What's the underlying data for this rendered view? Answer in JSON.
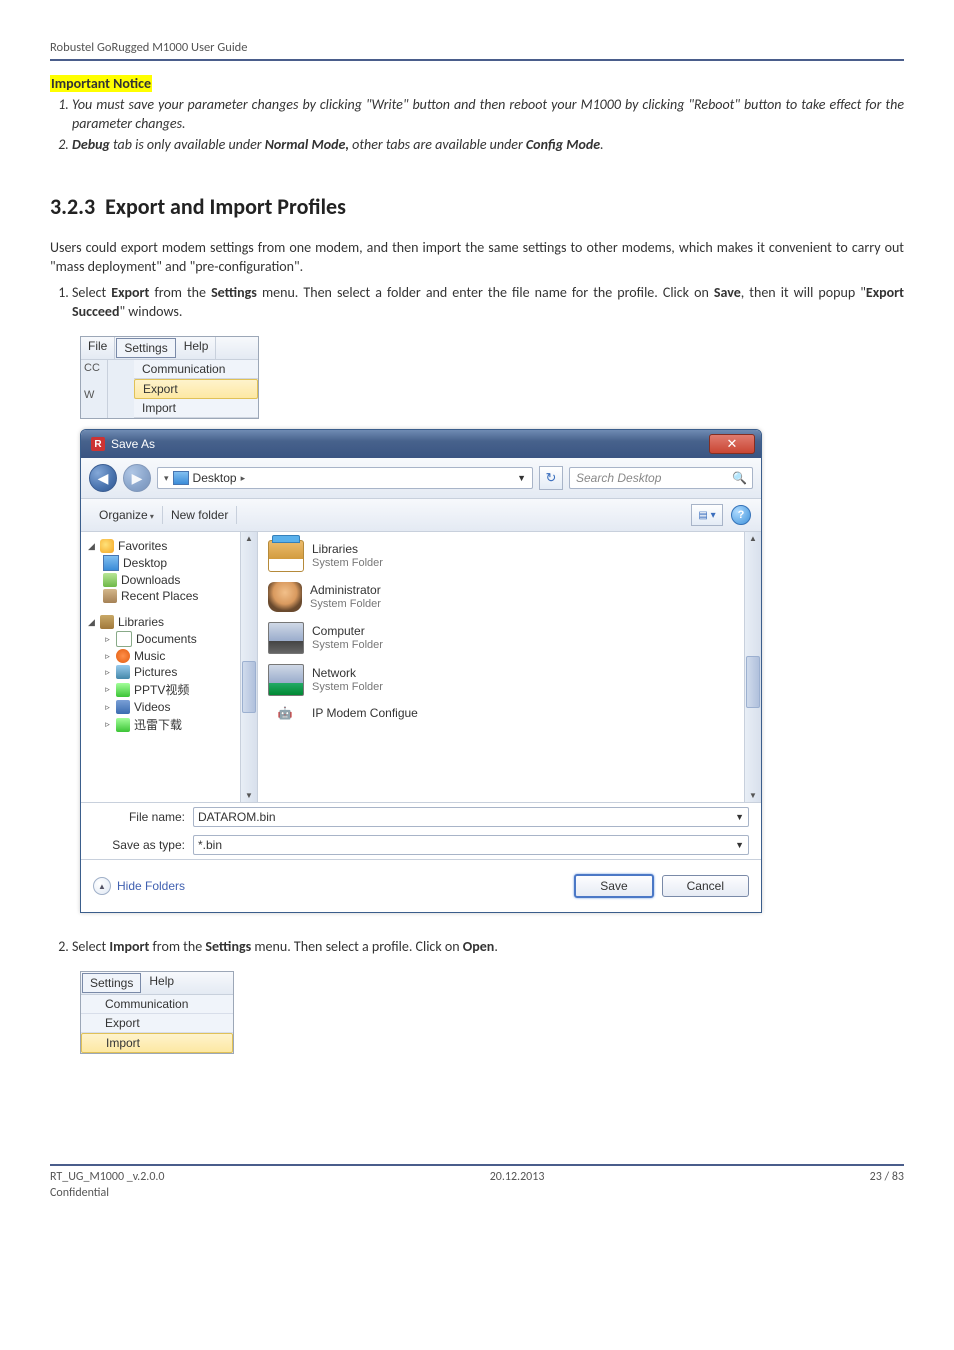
{
  "header": {
    "title": "Robustel GoRugged M1000 User Guide"
  },
  "notice_heading": "Important Notice",
  "notices": [
    "You must save your parameter changes by clicking \"Write\" button and then reboot your M1000 by clicking \"Reboot\" button to take effect for the parameter changes.",
    "Debug tab is only available under Normal Mode, other tabs are available under Config Mode."
  ],
  "notice_bold": {
    "debug": "Debug",
    "normal": "Normal Mode,",
    "config": "Config Mode"
  },
  "section": {
    "number": "3.2.3",
    "title": "Export and Import Profiles"
  },
  "intro": "Users could export modem settings from one modem, and then import the same settings to other modems, which makes it convenient to carry out \"mass deployment\" and \"pre-configuration\".",
  "step1_lead": "Select ",
  "step1_bold1": "Export",
  "step1_mid1": " from the ",
  "step1_bold2": "Settings",
  "step1_mid2": " menu. Then select a folder and enter the file name for the profile. Click on ",
  "step1_bold3": "Save",
  "step1_mid3": ", then it will popup \"",
  "step1_bold4": "Export Succeed",
  "step1_tail": "\" windows.",
  "appmenu": {
    "file": "File",
    "settings": "Settings",
    "help": "Help",
    "bound1": "CC",
    "bound2": "W",
    "comm": "Communication",
    "export": "Export",
    "import": "Import"
  },
  "saveas": {
    "title": "Save As",
    "breadcrumb": "Desktop",
    "search_placeholder": "Search Desktop",
    "organize": "Organize",
    "newfolder": "New folder",
    "tree": {
      "favorites": "Favorites",
      "desktop": "Desktop",
      "downloads": "Downloads",
      "recent": "Recent Places",
      "libraries": "Libraries",
      "documents": "Documents",
      "music": "Music",
      "pictures": "Pictures",
      "pptv": "PPTV视频",
      "videos": "Videos",
      "xunlei": "迅雷下载"
    },
    "files": {
      "libraries": "Libraries",
      "sysfolder": "System Folder",
      "admin": "Administrator",
      "computer": "Computer",
      "network": "Network",
      "ipmodem": "IP Modem Configue"
    },
    "filename_label": "File name:",
    "filename_value": "DATAROM.bin",
    "savetype_label": "Save as type:",
    "savetype_value": "*.bin",
    "hide": "Hide Folders",
    "save": "Save",
    "cancel": "Cancel"
  },
  "step2_lead": "Select ",
  "step2_bold1": "Import",
  "step2_mid1": " from the ",
  "step2_bold2": "Settings",
  "step2_mid2": " menu. Then select a profile. Click on ",
  "step2_bold3": "Open",
  "step2_tail": ".",
  "footer": {
    "left": "RT_UG_M1000 _v.2.0.0",
    "center": "20.12.2013",
    "right": "23 / 83",
    "conf": "Confidential"
  }
}
